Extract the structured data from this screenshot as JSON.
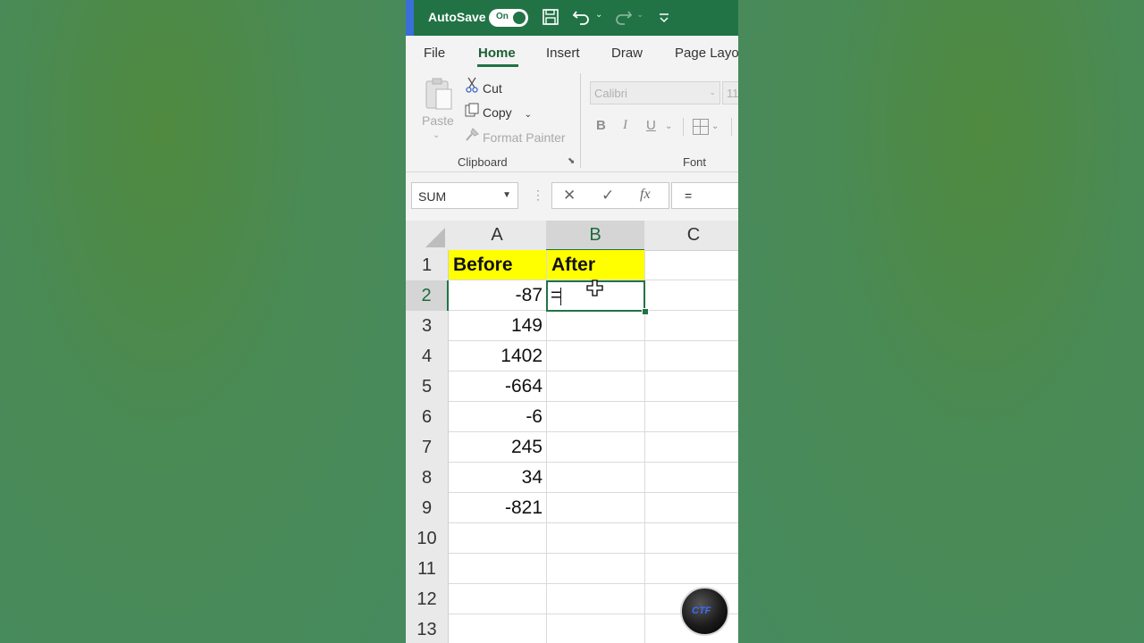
{
  "titlebar": {
    "autosave_label": "AutoSave",
    "autosave_state": "On",
    "accent": "#217346"
  },
  "tabs": [
    {
      "label": "File"
    },
    {
      "label": "Home",
      "active": true
    },
    {
      "label": "Insert"
    },
    {
      "label": "Draw"
    },
    {
      "label": "Page Layo"
    }
  ],
  "ribbon": {
    "clipboard": {
      "paste_label": "Paste",
      "cut_label": "Cut",
      "copy_label": "Copy",
      "format_painter_label": "Format Painter",
      "group_label": "Clipboard"
    },
    "font": {
      "font_name": "Calibri",
      "font_size": "11",
      "bold": "B",
      "italic": "I",
      "underline": "U",
      "group_label": "Font"
    }
  },
  "formula_bar": {
    "name_box": "SUM",
    "cancel_icon": "✕",
    "enter_icon": "✓",
    "fx_label": "fx",
    "formula": "="
  },
  "sheet": {
    "columns": [
      "A",
      "B",
      "C"
    ],
    "selected_column": "B",
    "rows": [
      "1",
      "2",
      "3",
      "4",
      "5",
      "6",
      "7",
      "8",
      "9",
      "10",
      "11",
      "12",
      "13"
    ],
    "selected_row": "2",
    "headers": {
      "A1": "Before",
      "B1": "After"
    },
    "before_values": [
      "-87",
      "149",
      "1402",
      "-664",
      "-6",
      "245",
      "34",
      "-821"
    ],
    "active_cell": "B2",
    "active_cell_content": "=",
    "header_fill": "#ffff00"
  },
  "watermark": {
    "text": "CTF"
  }
}
